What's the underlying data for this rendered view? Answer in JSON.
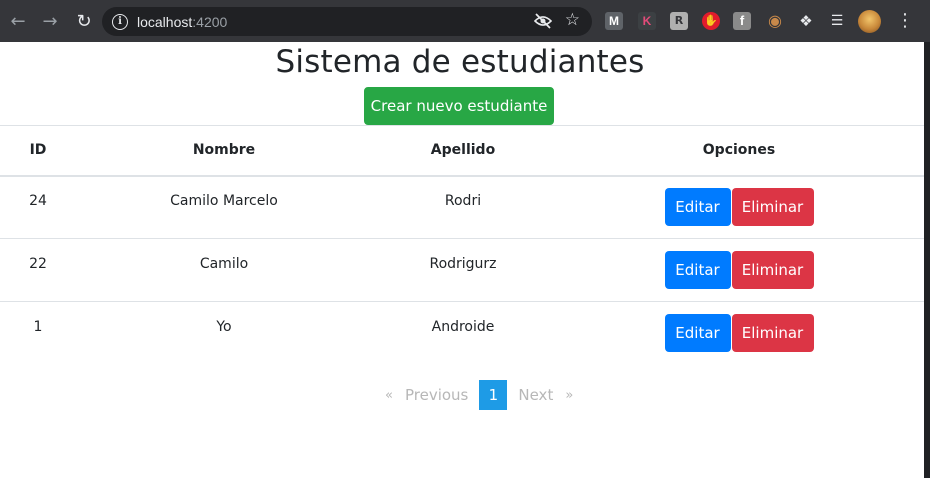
{
  "browser": {
    "url_host": "localhost",
    "url_port": ":4200",
    "extensions": [
      "M",
      "K",
      "R",
      "",
      "f",
      "",
      "",
      ""
    ]
  },
  "page": {
    "title": "Sistema de estudiantes",
    "create_button": "Crear nuevo estudiante"
  },
  "table": {
    "headers": [
      "ID",
      "Nombre",
      "Apellido",
      "Opciones"
    ],
    "rows": [
      {
        "id": "24",
        "nombre": "Camilo Marcelo",
        "apellido": "Rodri",
        "edit": "Editar",
        "delete": "Eliminar"
      },
      {
        "id": "22",
        "nombre": "Camilo",
        "apellido": "Rodrigurz",
        "edit": "Editar",
        "delete": "Eliminar"
      },
      {
        "id": "1",
        "nombre": "Yo",
        "apellido": "Androide",
        "edit": "Editar",
        "delete": "Eliminar"
      }
    ]
  },
  "pagination": {
    "prev_arrow": "«",
    "previous": "Previous",
    "current": "1",
    "next": "Next",
    "next_arrow": "»"
  },
  "colors": {
    "success": "#28a745",
    "primary": "#007bff",
    "danger": "#dc3545",
    "page_active": "#1e9be6"
  }
}
